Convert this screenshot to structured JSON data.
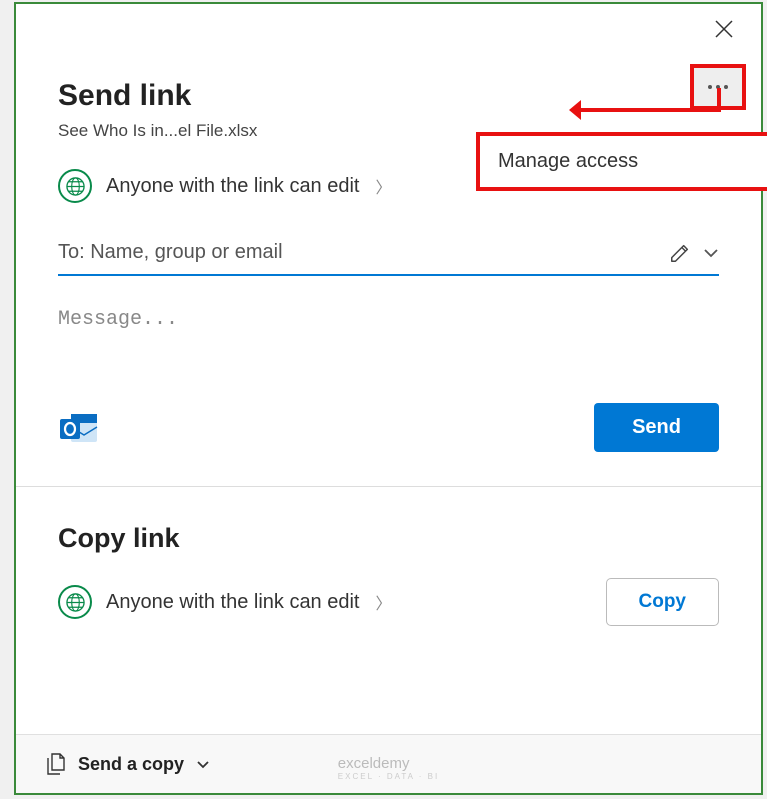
{
  "dialog": {
    "title": "Send link",
    "subtitle": "See Who Is in...el File.xlsx",
    "scope_text": "Anyone with the link can edit",
    "to_placeholder": "To: Name, group or email",
    "message_placeholder": "Message...",
    "send_label": "Send",
    "copy_title": "Copy link",
    "copy_scope_text": "Anyone with the link can edit",
    "copy_label": "Copy",
    "footer_label": "Send a copy"
  },
  "annotation": {
    "manage_access_label": "Manage access"
  },
  "watermark": {
    "brand": "exceldemy",
    "tagline": "EXCEL · DATA · BI"
  },
  "colors": {
    "primary": "#0078d4",
    "annotation_red": "#e81111",
    "dialog_border": "#3a8a3a",
    "globe_green": "#098a4a"
  }
}
